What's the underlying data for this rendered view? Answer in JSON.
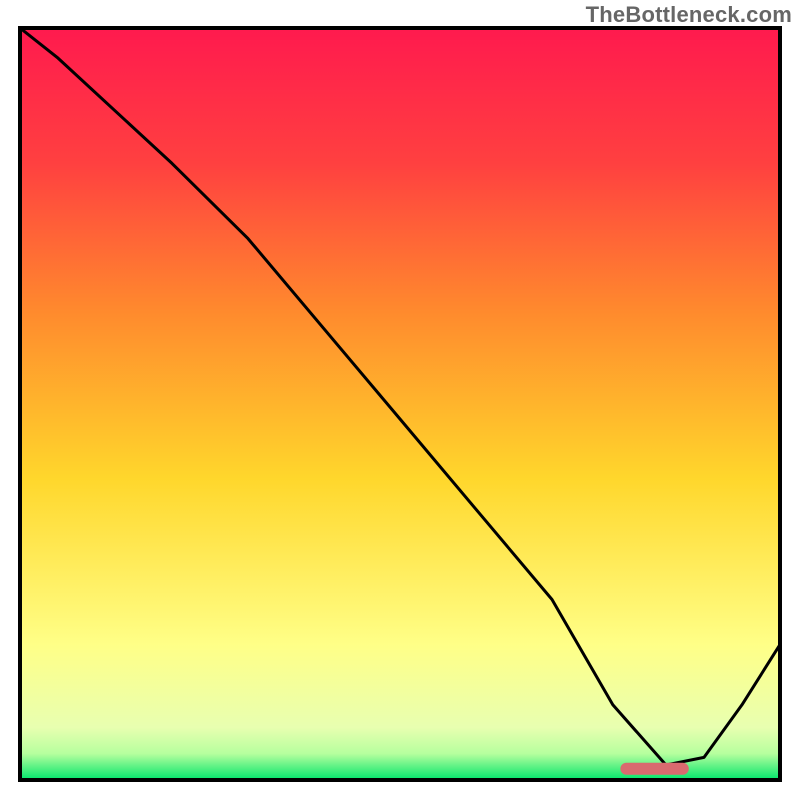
{
  "watermark": "TheBottleneck.com",
  "chart_data": {
    "type": "line",
    "title": "",
    "xlabel": "",
    "ylabel": "",
    "xlim": [
      0,
      100
    ],
    "ylim": [
      0,
      100
    ],
    "grid": false,
    "legend": false,
    "background_gradient": {
      "top_color": "#ff1a4e",
      "upper_mid_color": "#ff8b2d",
      "mid_color": "#ffd72c",
      "lower_mid_color": "#ffff87",
      "bottom_color": "#00e56b"
    },
    "series": [
      {
        "name": "bottleneck-curve",
        "x": [
          0,
          5,
          20,
          30,
          40,
          50,
          60,
          70,
          78,
          85,
          90,
          95,
          100
        ],
        "y": [
          100,
          96,
          82,
          72,
          60,
          48,
          36,
          24,
          10,
          2,
          3,
          10,
          18
        ]
      }
    ],
    "optimal_marker": {
      "x_start": 79,
      "x_end": 88,
      "y": 1.5,
      "color": "#d96a6f"
    },
    "frame": {
      "stroke": "#000000",
      "stroke_width": 4
    }
  }
}
